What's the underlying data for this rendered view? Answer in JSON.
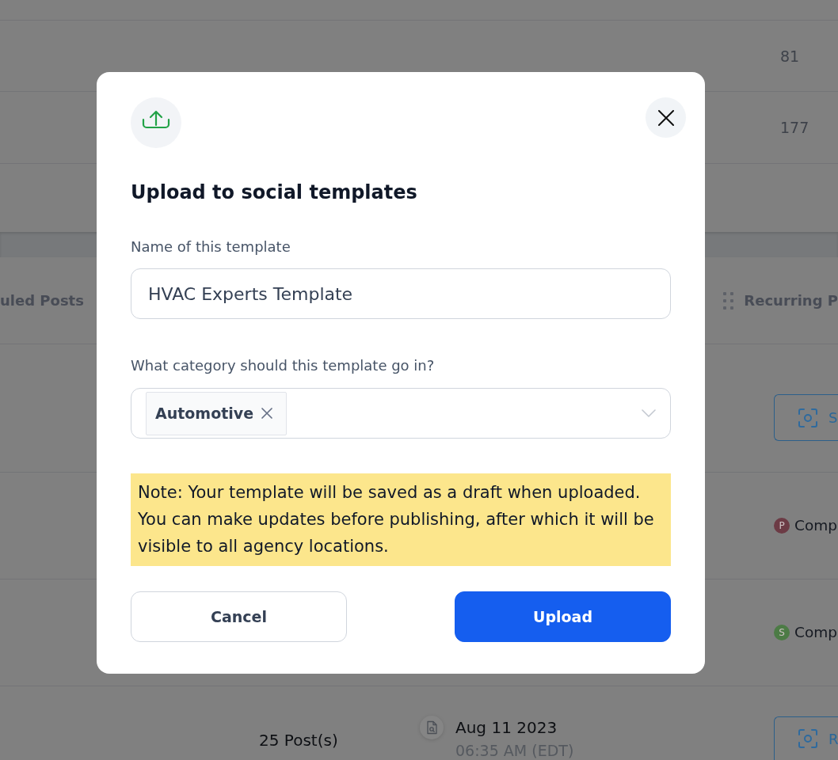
{
  "background": {
    "summary_rows": [
      {
        "value": "81"
      },
      {
        "value": "177"
      }
    ],
    "columns": [
      {
        "label": "uled Posts",
        "drag_handle": false
      },
      {
        "label": "Recurring P",
        "drag_handle": true
      }
    ],
    "rows": [
      {
        "kind": "action",
        "button": "S"
      },
      {
        "kind": "status",
        "initial": "P",
        "color": "#6c3b45",
        "status": "Comp"
      },
      {
        "kind": "status",
        "initial": "S",
        "color": "#4c7b45",
        "status": "Comp"
      },
      {
        "kind": "post",
        "posts": "25 Post(s)",
        "date": "Aug 11 2023",
        "time": "06:35 AM (EDT)",
        "button": "R"
      }
    ]
  },
  "modal": {
    "title": "Upload to social templates",
    "fields": [
      {
        "kind": "text",
        "label": "Name of this template",
        "value": "HVAC Experts Template"
      },
      {
        "kind": "tags",
        "label": "What category should this template go in?",
        "tags": [
          "Automotive"
        ]
      }
    ],
    "note": "Note: Your template will be saved as a draft when uploaded. You can make updates before publishing, after which it will be visible to all agency locations.",
    "buttons": [
      {
        "kind": "secondary",
        "label": "Cancel"
      },
      {
        "kind": "primary",
        "label": "Upload"
      }
    ]
  }
}
